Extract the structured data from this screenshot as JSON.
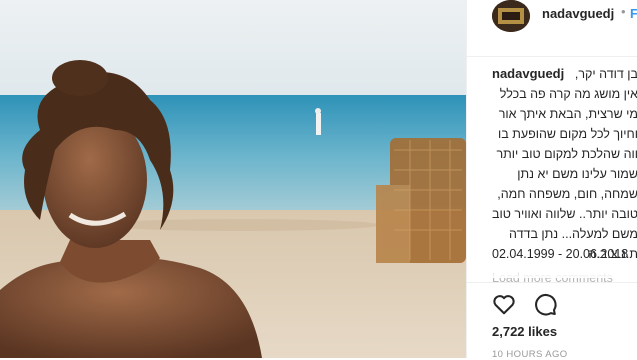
{
  "post": {
    "username": "nadavguedj",
    "follow_dot": "•",
    "follow_label": "F",
    "caption_username": "nadavguedj",
    "caption_lines": [
      "בן דודה יקר,",
      "אין מושג מה קרה פה בכלל",
      "מי שרצית, הבאת איתך אור",
      "וחיוך לכל מקום שהופעת בו",
      "ווה שהלכת למקום טוב יותר",
      "שמור עלינו משם יא נתן",
      "שמחה, חום, משפחה חמה,",
      "טובה יותר.. שלווה ואוויר טוב",
      "משם למעלה... נתן בדדה",
      "ת.נ.צ.ב.ה"
    ],
    "dates": "02.04.1999 - 20.06.2018",
    "load_more": "Load more comments",
    "likes": "2,722 likes",
    "timestamp": "10 HOURS AGO"
  },
  "icons": {
    "like": "heart-icon",
    "comment": "comment-icon"
  },
  "colors": {
    "link_blue": "#3897f0",
    "text": "#262626",
    "muted": "#999999"
  }
}
